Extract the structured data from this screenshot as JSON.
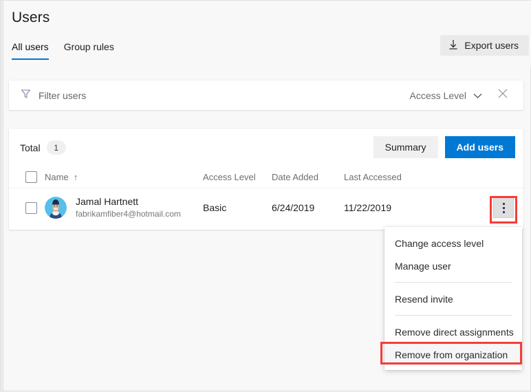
{
  "header": {
    "title": "Users",
    "tabs": [
      {
        "label": "All users",
        "active": true
      },
      {
        "label": "Group rules",
        "active": false
      }
    ],
    "export_button": {
      "label": "Export users",
      "icon": "download-icon"
    }
  },
  "filter_bar": {
    "icon": "funnel-icon",
    "label": "Filter users",
    "access_level": {
      "label": "Access Level",
      "chevron": "chevron-down-icon"
    },
    "clear": "close-icon"
  },
  "table_toolbar": {
    "total_label": "Total",
    "total_count": "1",
    "summary_label": "Summary",
    "add_users_label": "Add users"
  },
  "table": {
    "columns": [
      {
        "key": "name",
        "label": "Name",
        "sort": "↑"
      },
      {
        "key": "access",
        "label": "Access Level"
      },
      {
        "key": "added",
        "label": "Date Added"
      },
      {
        "key": "last",
        "label": "Last Accessed"
      }
    ],
    "rows": [
      {
        "name": "Jamal Hartnett",
        "email": "fabrikamfiber4@hotmail.com",
        "access": "Basic",
        "added": "6/24/2019",
        "last": "11/22/2019",
        "avatar": "user-avatar",
        "more": "kebab-menu-icon"
      }
    ]
  },
  "context_menu": {
    "items": [
      {
        "label": "Change access level",
        "separator_after": false
      },
      {
        "label": "Manage user",
        "separator_after": true
      },
      {
        "label": "Resend invite",
        "separator_after": true
      },
      {
        "label": "Remove direct assignments",
        "separator_after": false
      },
      {
        "label": "Remove from organization",
        "separator_after": false,
        "highlighted": true
      }
    ]
  },
  "colors": {
    "accent": "#0078d4",
    "highlight": "#f53c38",
    "avatar_bg": "#55c0e8",
    "avatar_hair": "#1d2b4c",
    "avatar_skin": "#e8b894",
    "avatar_shirt": "#2a4b86"
  }
}
